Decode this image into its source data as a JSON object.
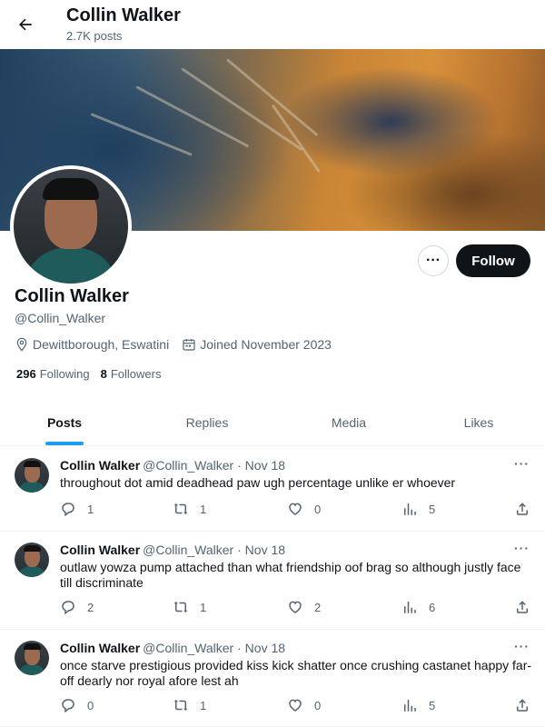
{
  "header": {
    "name": "Collin Walker",
    "posts_count": "2.7K posts"
  },
  "profile": {
    "name": "Collin Walker",
    "handle": "@Collin_Walker",
    "location": "Dewittborough, Eswatini",
    "joined": "Joined November 2023",
    "following_count": "296",
    "following_label": "Following",
    "followers_count": "8",
    "followers_label": "Followers",
    "follow_label": "Follow",
    "more_label": "···"
  },
  "tabs": [
    {
      "label": "Posts",
      "active": true
    },
    {
      "label": "Replies",
      "active": false
    },
    {
      "label": "Media",
      "active": false
    },
    {
      "label": "Likes",
      "active": false
    }
  ],
  "posts": [
    {
      "name": "Collin Walker",
      "handle": "@Collin_Walker",
      "date": "· Nov 18",
      "text": "throughout dot amid deadhead paw ugh percentage unlike er whoever",
      "replies": "1",
      "reposts": "1",
      "likes": "0",
      "views": "5"
    },
    {
      "name": "Collin Walker",
      "handle": "@Collin_Walker",
      "date": "· Nov 18",
      "text": "outlaw yowza pump attached than what friendship oof brag so although justly face till discriminate",
      "replies": "2",
      "reposts": "1",
      "likes": "2",
      "views": "6"
    },
    {
      "name": "Collin Walker",
      "handle": "@Collin_Walker",
      "date": "· Nov 18",
      "text": "once starve prestigious provided kiss kick shatter once crushing castanet happy far-off dearly nor royal afore lest ah",
      "replies": "0",
      "reposts": "1",
      "likes": "0",
      "views": "5"
    }
  ],
  "icons": {
    "back": "arrow-left-icon",
    "location": "location-pin-icon",
    "calendar": "calendar-icon",
    "reply": "reply-icon",
    "repost": "repost-icon",
    "like": "heart-icon",
    "views": "views-icon",
    "share": "share-icon"
  },
  "colors": {
    "accent": "#1d9bf0",
    "follow_bg": "#0f1419",
    "secondary_text": "#536471"
  }
}
